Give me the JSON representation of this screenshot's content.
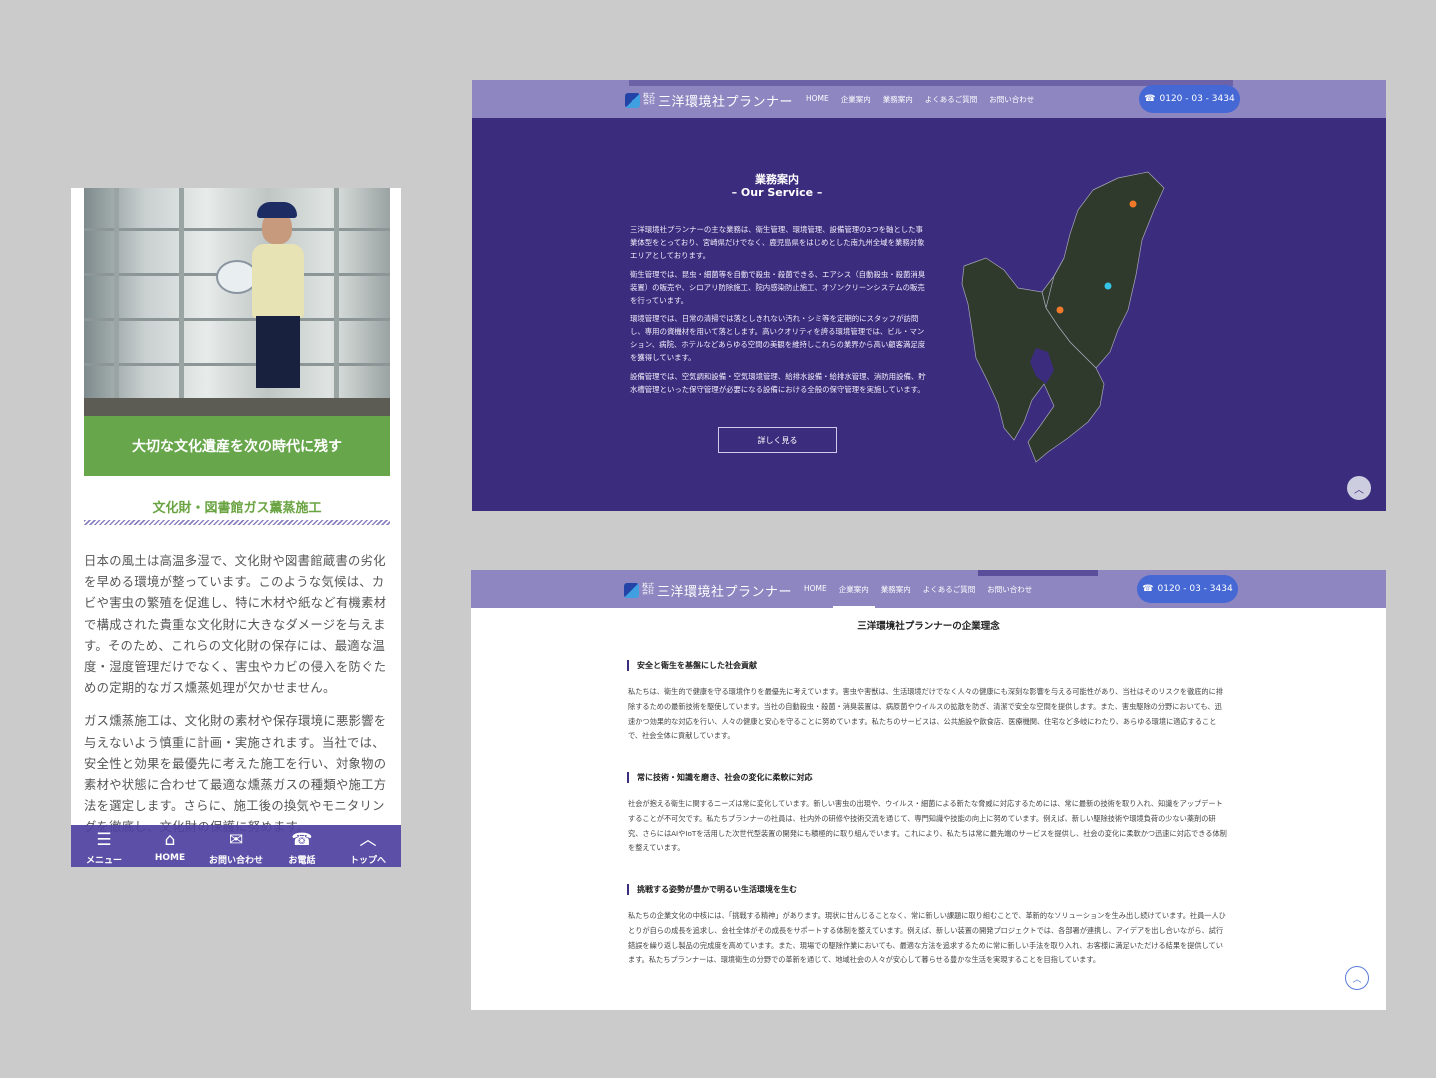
{
  "mobile": {
    "banner": "大切な文化遺産を次の時代に残す",
    "heading": "文化財・図書館ガス薫蒸施工",
    "paragraphs": [
      "日本の風土は高温多湿で、文化財や図書館蔵書の劣化を早める環境が整っています。このような気候は、カビや害虫の繁殖を促進し、特に木材や紙など有機素材で構成された貴重な文化財に大きなダメージを与えます。そのため、これらの文化財の保存には、最適な温度・湿度管理だけでなく、害虫やカビの侵入を防ぐための定期的なガス燻蒸処理が欠かせません。",
      "ガス燻蒸施工は、文化財の素材や保存環境に悪影響を与えないよう慎重に計画・実施されます。当社では、安全性と効果を最優先に考えた施工を行い、対象物の素材や状態に合わせて最適な燻蒸ガスの種類や施工方法を選定します。さらに、施工後の換気やモニタリングを徹底し、文化財の保護に努めます。"
    ],
    "bottom_nav": [
      {
        "icon": "menu-icon",
        "label": "メニュー"
      },
      {
        "icon": "home-icon",
        "label": "HOME"
      },
      {
        "icon": "mail-icon",
        "label": "お問い合わせ"
      },
      {
        "icon": "phone-icon",
        "label": "お電話"
      },
      {
        "icon": "chevron-up-icon",
        "label": "トップへ"
      }
    ]
  },
  "header": {
    "logo_small": "株式会社",
    "logo_text": "三洋環境社プランナー",
    "nav": [
      "HOME",
      "企業案内",
      "業務案内",
      "よくあるご質問",
      "お問い合わせ"
    ],
    "phone": "0120 - 03 - 3434"
  },
  "service": {
    "title": "業務案内",
    "subtitle": "– Our Service –",
    "paragraphs": [
      "三洋環境社プランナーの主な業務は、衛生管理、環境管理、設備管理の3つを軸とした事業体型をとっており、宮崎県だけでなく、鹿児島県をはじめとした南九州全域を業務対象エリアとしております。",
      "衛生管理では、昆虫・細菌等を自動で殺虫・殺菌できる、エアシス（自動殺虫・殺菌消臭装置）の販売や、シロアリ防除施工、院内感染防止施工、オゾンクリーンシステムの販売を行っています。",
      "環境管理では、日常の清掃では落としきれない汚れ・シミ等を定期的にスタッフが訪問し、専用の資機材を用いて落とします。高いクオリティを誇る環境管理では、ビル・マンション、病院、ホテルなどあらゆる空間の美観を維持しこれらの業界から高い顧客満足度を獲得しています。",
      "設備管理では、空気調和設備・空気環境管理、給排水設備・給排水管理、消防用設備、貯水槽管理といった保守管理が必要になる設備における全般の保守管理を実施しています。"
    ],
    "button": "詳しく見る",
    "map_colors": {
      "land": "#2f3a2c",
      "border": "#a7a7b8",
      "orange": "#f07a2a",
      "cyan": "#35c3e6"
    }
  },
  "philosophy": {
    "title": "三洋環境社プランナーの企業理念",
    "sections": [
      {
        "heading": "安全と衛生を基盤にした社会貢献",
        "text": "私たちは、衛生的で健康を守る環境作りを最優先に考えています。害虫や害獣は、生活環境だけでなく人々の健康にも深刻な影響を与える可能性があり、当社はそのリスクを徹底的に排除するための最新技術を駆使しています。当社の自動殺虫・殺菌・消臭装置は、病原菌やウイルスの拡散を防ぎ、清潔で安全な空間を提供します。また、害虫駆除の分野においても、迅速かつ効果的な対応を行い、人々の健康と安心を守ることに努めています。私たちのサービスは、公共施設や飲食店、医療機関、住宅など多岐にわたり、あらゆる環境に適応することで、社会全体に貢献しています。"
      },
      {
        "heading": "常に技術・知識を磨き、社会の変化に柔軟に対応",
        "text": "社会が抱える衛生に関するニーズは常に変化しています。新しい害虫の出現や、ウイルス・細菌による新たな脅威に対応するためには、常に最新の技術を取り入れ、知識をアップデートすることが不可欠です。私たちプランナーの社員は、社内外の研修や技術交流を通じて、専門知識や技能の向上に努めています。例えば、新しい駆除技術や環境負荷の少ない薬剤の研究、さらにはAIやIoTを活用した次世代型装置の開発にも積極的に取り組んでいます。これにより、私たちは常に最先端のサービスを提供し、社会の変化に柔軟かつ迅速に対応できる体制を整えています。"
      },
      {
        "heading": "挑戦する姿勢が豊かで明るい生活環境を生む",
        "text": "私たちの企業文化の中核には、「挑戦する精神」があります。現状に甘んじることなく、常に新しい課題に取り組むことで、革新的なソリューションを生み出し続けています。社員一人ひとりが自らの成長を追求し、会社全体がその成長をサポートする体制を整えています。例えば、新しい装置の開発プロジェクトでは、各部署が連携し、アイデアを出し合いながら、試行錯誤を繰り返し製品の完成度を高めています。また、現場での駆除作業においても、最適な方法を追求するために常に新しい手法を取り入れ、お客様に満足いただける結果を提供しています。私たちプランナーは、環境衛生の分野での革新を通じて、地域社会の人々が安心して暮らせる豊かな生活を実現することを目指しています。"
      }
    ]
  }
}
